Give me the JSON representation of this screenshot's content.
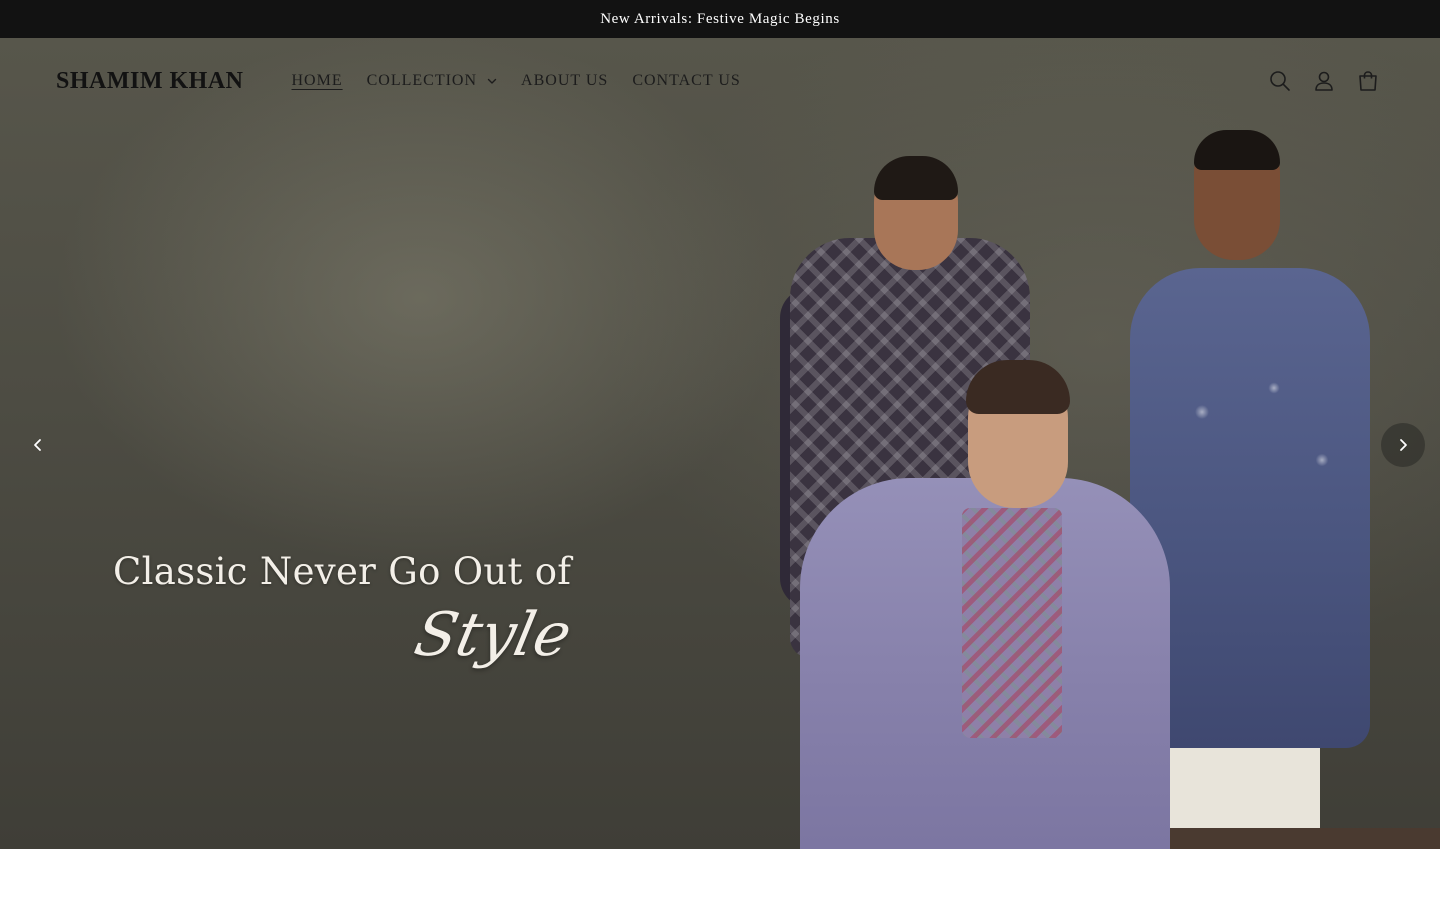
{
  "announcement": {
    "text": "New Arrivals: Festive Magic Begins"
  },
  "header": {
    "logo": "SHAMIM KHAN",
    "nav": [
      {
        "label": "HOME",
        "active": true
      },
      {
        "label": "COLLECTION",
        "has_dropdown": true
      },
      {
        "label": "ABOUT US"
      },
      {
        "label": "CONTACT US"
      }
    ],
    "icons": [
      "search-icon",
      "account-icon",
      "cart-icon"
    ]
  },
  "hero": {
    "heading": "Classic Never Go Out of",
    "script": "Style",
    "controls": [
      "chevron-left-icon",
      "chevron-right-icon"
    ]
  },
  "colors": {
    "announcement_bg": "#121212",
    "announcement_text": "#ffffff",
    "nav_text": "#1c1c1c",
    "hero_text": "#f3efe8"
  }
}
